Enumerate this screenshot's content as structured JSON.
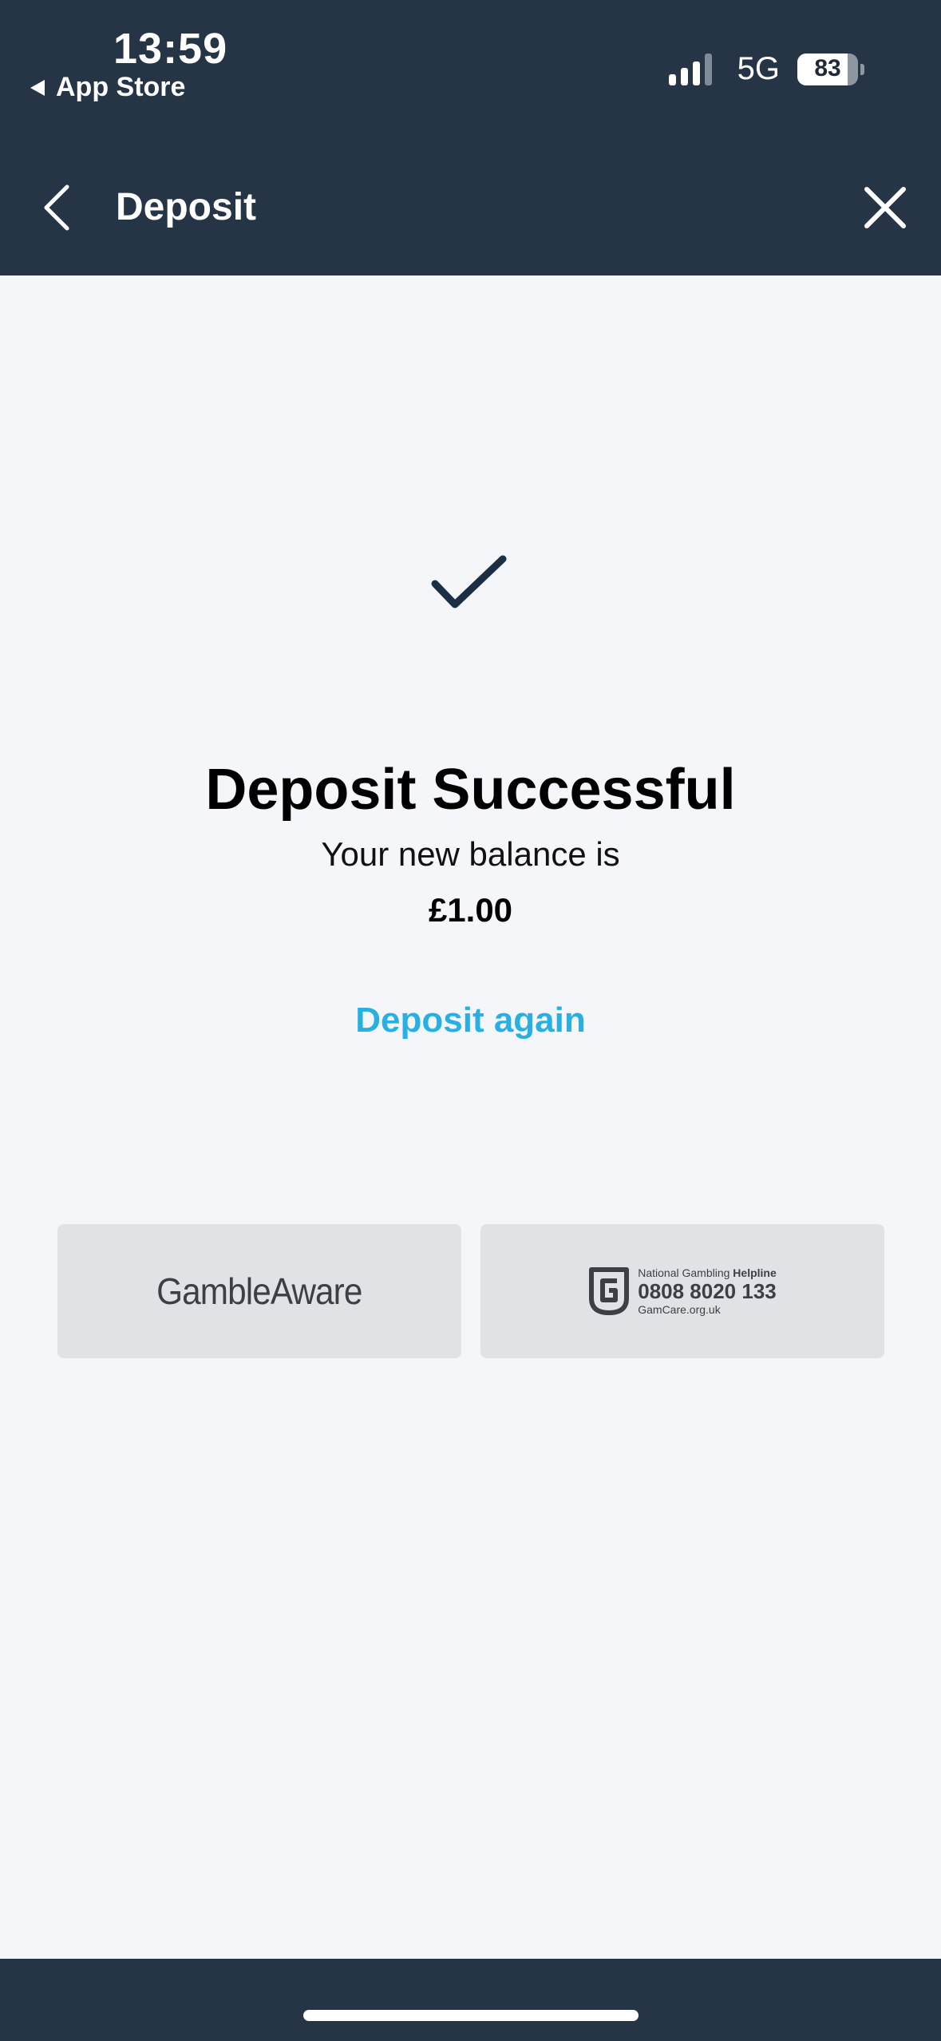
{
  "status_bar": {
    "time": "13:59",
    "back_app": "App Store",
    "network": "5G",
    "battery_percent": "83",
    "battery_level": 0.83
  },
  "header": {
    "title": "Deposit",
    "back_icon": "chevron-left-icon",
    "close_icon": "close-icon"
  },
  "result": {
    "icon": "checkmark-icon",
    "title": "Deposit Successful",
    "subtitle": "Your new balance is",
    "balance": "£1.00",
    "action_label": "Deposit again"
  },
  "partners": {
    "gambleaware": "GambleAware",
    "helpline": {
      "prefix": "National Gambling ",
      "emphasis": "Helpline",
      "phone": "0808 8020 133",
      "site": "GamCare.org.uk"
    }
  },
  "colors": {
    "header_bg": "#253545",
    "page_bg": "#f4f6f9",
    "accent": "#29b0e3",
    "check": "#1c2e45",
    "card_bg": "#e1e2e5"
  }
}
